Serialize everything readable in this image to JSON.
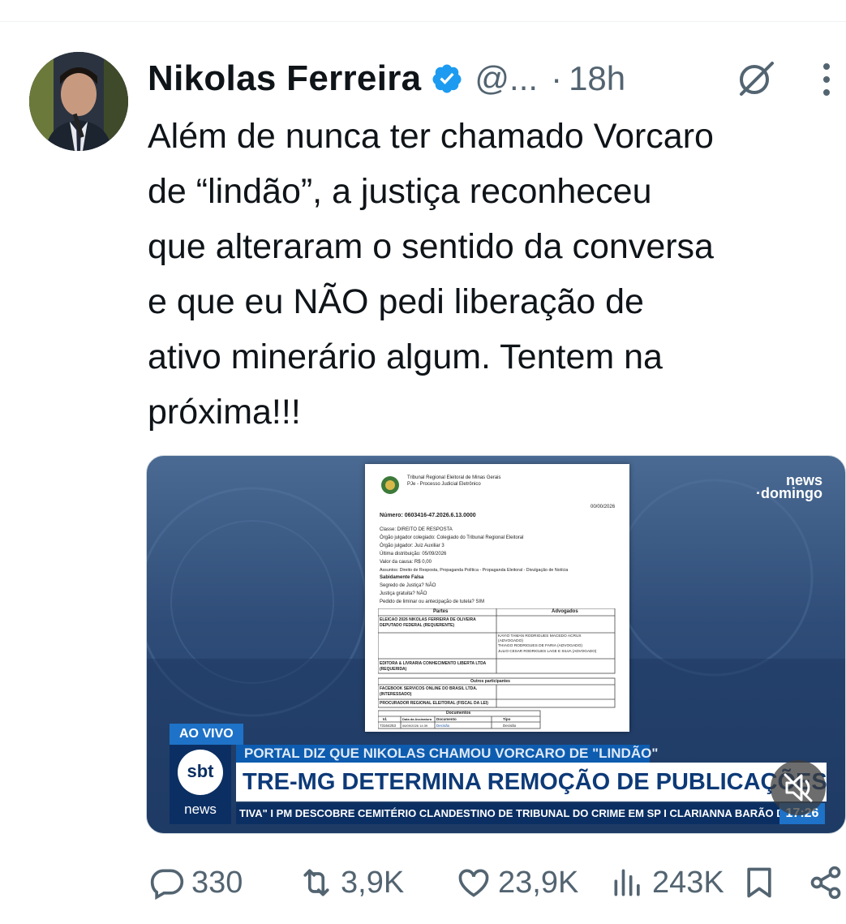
{
  "author": {
    "name": "Nikolas Ferreira",
    "handle": "@...",
    "separator": "·",
    "time": "18h"
  },
  "tweet": {
    "text": "Além de nunca ter chamado Vorcaro\nde “lindão”, a justiça reconheceu\nque alteraram o sentido da conversa\ne que eu NÃO pedi liberação de\nativo minerário algum. Tentem na\npróxima!!!"
  },
  "media": {
    "channel_mark": "news\n·domingo",
    "live_label": "AO VIVO",
    "subheadline": "PORTAL DIZ QUE NIKOLAS CHAMOU VORCARO DE \"LINDÃO\"",
    "headline": "TRE-MG DETERMINA REMOÇÃO DE PUBLICAÇÕES NO SITE DO",
    "ticker": "TIVA\"  I  PM DESCOBRE CEMITÉRIO CLANDESTINO DE TRIBUNAL DO CRIME EM SP  I  CLARIANNA BARÃO DEF",
    "clock": "17:26",
    "logo_text": "sbt",
    "logo_sub": "news",
    "document": {
      "court": "Tribunal Regional Eleitoral de Minas Gerais",
      "system": "PJe - Processo Judicial Eletrônico",
      "date": "00/00/2026",
      "number": "Número: 0603416-47.2026.6.13.0000",
      "classe": "Classe: DIREITO DE RESPOSTA",
      "orgao": "Órgão julgador colegiado: Colegiado do Tribunal Regional Eleitoral",
      "orgao2": "Órgão julgador: Juiz Auxiliar 3",
      "distrib": "Última distribuição: 05/09/2026",
      "valor": "Valor da causa: R$ 0,00",
      "assuntos": "Assuntos: Direito de Resposta, Propaganda Política - Propaganda Eleitoral - Divulgação de Notícia",
      "assuntos2": "Sabidamente Falsa",
      "segredo": "Segredo de Justiça? NÃO",
      "gratuita": "Justiça gratuita? NÃO",
      "liminar": "Pedido de liminar ou antecipação de tutela? SIM",
      "col_partes": "Partes",
      "col_advogados": "Advogados",
      "parte1": "ELEICAO 2026 NIKOLAS FERREIRA DE OLIVEIRA",
      "parte1b": "DEPUTADO FEDERAL (REQUERENTE)",
      "adv1": "KAYIO TAMAN RODRIGUES MACEDO ACRUX",
      "adv1b": "(ADVOGADO)",
      "adv2": "THIAGO RODRIGUES DE FARIA (ADVOGADO)",
      "adv3": "JULIO CESAR RODRIGUES LAGE E SILVA (ADVOGADO)",
      "parte2": "EDITORA & LIVRARIA CONHECIMENTO LIBERTA LTDA",
      "parte2b": "(REQUERIDA)",
      "outros": "Outros participantes",
      "outro1": "FACEBOOK SERVICOS ONLINE DO BRASIL LTDA.",
      "outro1b": "(INTERESSADO)",
      "outro2": "PROCURADOR REGIONAL ELEITORAL (FISCAL DA LEI)",
      "docs": "Documentos",
      "doc_cols": [
        "Id.",
        "Data da Assinatura",
        "Documento",
        "Tipo"
      ],
      "doc_row": [
        "73164253",
        "06/09/2026 14:39",
        "Decisão",
        "Decisão"
      ]
    }
  },
  "actions": {
    "replies": "330",
    "reposts": "3,9K",
    "likes": "23,9K",
    "views": "243K"
  },
  "colors": {
    "text": "#0f1419",
    "secondary": "#536471",
    "verified": "#1d9bf0"
  }
}
